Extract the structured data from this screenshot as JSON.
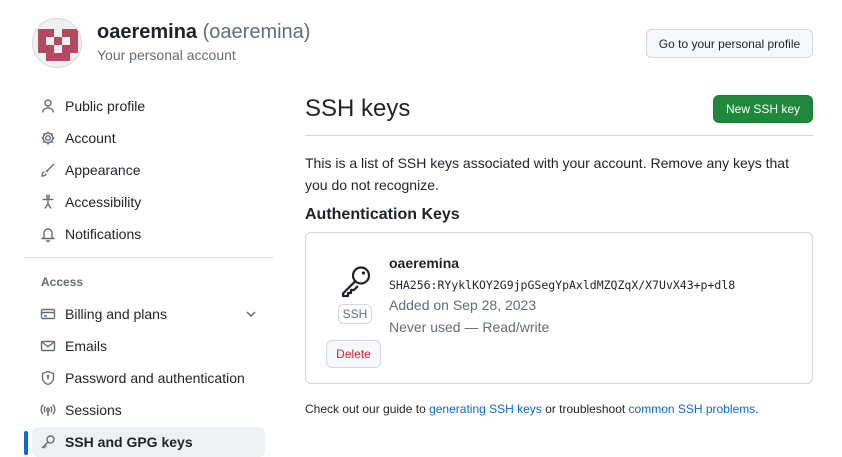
{
  "user": {
    "display_name": "oaeremina",
    "login": "(oaeremina)",
    "subtitle": "Your personal account"
  },
  "header": {
    "profile_button": "Go to your personal profile"
  },
  "sidebar": {
    "items": [
      {
        "label": "Public profile",
        "icon": "person-icon"
      },
      {
        "label": "Account",
        "icon": "gear-icon"
      },
      {
        "label": "Appearance",
        "icon": "paintbrush-icon"
      },
      {
        "label": "Accessibility",
        "icon": "accessibility-icon"
      },
      {
        "label": "Notifications",
        "icon": "bell-icon"
      }
    ],
    "access_heading": "Access",
    "access_items": [
      {
        "label": "Billing and plans",
        "icon": "credit-card-icon"
      },
      {
        "label": "Emails",
        "icon": "mail-icon"
      },
      {
        "label": "Password and authentication",
        "icon": "shield-lock-icon"
      },
      {
        "label": "Sessions",
        "icon": "broadcast-icon"
      },
      {
        "label": "SSH and GPG keys",
        "icon": "key-icon",
        "active": true
      }
    ]
  },
  "main": {
    "title": "SSH keys",
    "new_button": "New SSH key",
    "description": "This is a list of SSH keys associated with your account. Remove any keys that you do not recognize.",
    "section_title": "Authentication Keys",
    "keys": [
      {
        "title": "oaeremina",
        "fingerprint": "SHA256:RYyklKOY2G9jpGSegYpAxldMZQZqX/X7UvX43+p+dl8",
        "added": "Added on Sep 28, 2023",
        "usage": "Never used — Read/write",
        "type_label": "SSH",
        "delete_label": "Delete"
      }
    ],
    "footer": {
      "prefix": "Check out our guide to ",
      "link1": "generating SSH keys",
      "middle": " or troubleshoot ",
      "link2": "common SSH problems",
      "suffix": "."
    }
  },
  "colors": {
    "accent": "#0969da",
    "primary_button": "#1f883d",
    "danger": "#cf222e",
    "avatar": "#b6485f"
  }
}
